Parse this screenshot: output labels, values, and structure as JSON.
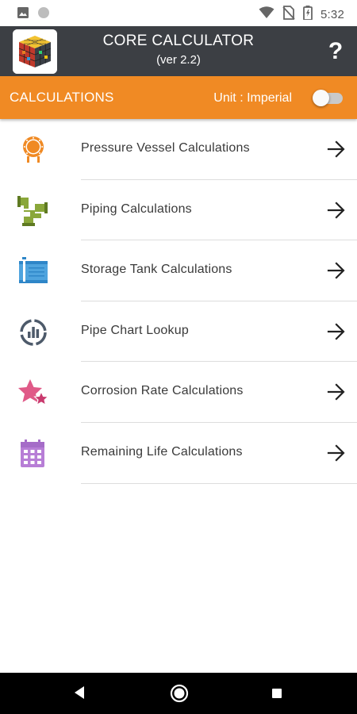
{
  "status_bar": {
    "time": "5:32",
    "icons": [
      "image-icon",
      "sync-circle-icon",
      "wifi-icon",
      "no-sim-icon",
      "battery-icon"
    ]
  },
  "header": {
    "title": "CORE CALCULATOR",
    "version": "(ver 2.2)",
    "help_label": "?",
    "logo_icon": "rubiks-cube-logo"
  },
  "section": {
    "title": "CALCULATIONS",
    "unit_label": "Unit : Imperial",
    "unit_toggle_on": false
  },
  "calculations": [
    {
      "label": "Pressure Vessel Calculations",
      "icon": "pressure-vessel-icon",
      "color": "#f08a24"
    },
    {
      "label": "Piping Calculations",
      "icon": "piping-icon",
      "color": "#8aa73a"
    },
    {
      "label": "Storage Tank Calculations",
      "icon": "storage-tank-icon",
      "color": "#2e86c8"
    },
    {
      "label": "Pipe Chart Lookup",
      "icon": "pipe-chart-icon",
      "color": "#4d5a6a"
    },
    {
      "label": "Corrosion Rate Calculations",
      "icon": "corrosion-stars-icon",
      "color": "#e05a88"
    },
    {
      "label": "Remaining Life Calculations",
      "icon": "calendar-icon",
      "color": "#a56cc8"
    }
  ],
  "colors": {
    "app_bar": "#3c3f44",
    "accent": "#f08a24"
  }
}
